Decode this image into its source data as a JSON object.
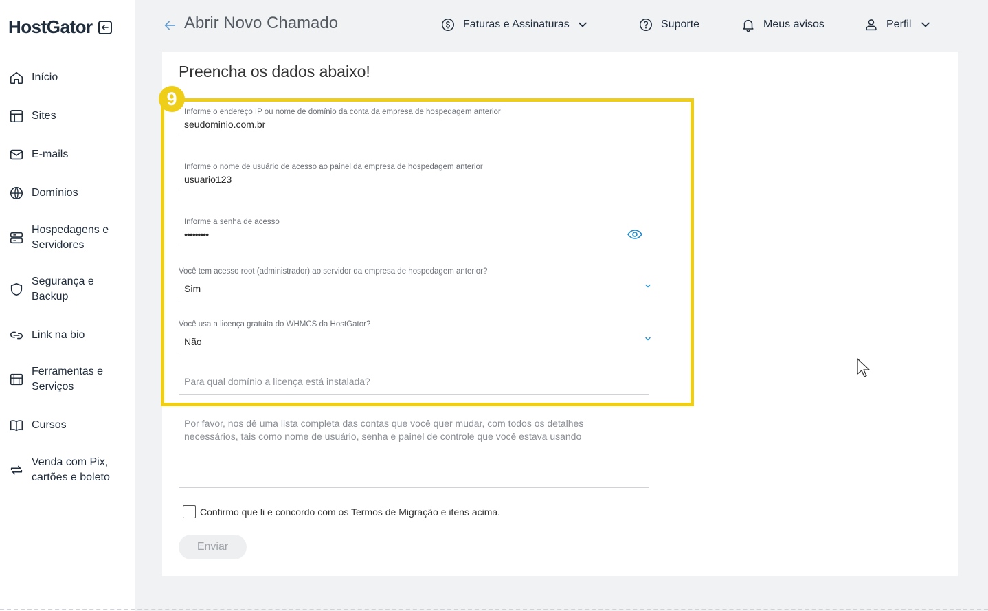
{
  "brand": {
    "name": "HostGator"
  },
  "sidebar": {
    "items": [
      {
        "label": "Início",
        "icon": "home-icon"
      },
      {
        "label": "Sites",
        "icon": "layout-icon"
      },
      {
        "label": "E-mails",
        "icon": "mail-icon"
      },
      {
        "label": "Domínios",
        "icon": "globe-icon"
      },
      {
        "label": "Hospedagens e Servidores",
        "icon": "server-icon"
      },
      {
        "label": "Segurança e Backup",
        "icon": "shield-icon"
      },
      {
        "label": "Link na bio",
        "icon": "link-icon"
      },
      {
        "label": "Ferramentas e Serviços",
        "icon": "tools-icon"
      },
      {
        "label": "Cursos",
        "icon": "book-icon"
      },
      {
        "label": "Venda com Pix, cartões e boleto",
        "icon": "exchange-icon"
      }
    ]
  },
  "header": {
    "title": "Abrir Novo Chamado",
    "nav": {
      "billing": "Faturas e Assinaturas",
      "support": "Suporte",
      "notifications": "Meus avisos",
      "profile": "Perfil"
    }
  },
  "form": {
    "title": "Preencha os dados abaixo!",
    "step_badge": "9",
    "ip_field": {
      "label": "Informe o endereço IP ou nome de domínio da conta da empresa de hospedagem anterior",
      "value": "seudominio.com.br"
    },
    "user_field": {
      "label": "Informe o nome de usuário de acesso ao painel da empresa de hospedagem anterior",
      "value": "usuario123"
    },
    "password_field": {
      "label": "Informe a senha de acesso",
      "value": "•••••••••"
    },
    "root_select": {
      "label": "Você tem acesso root (administrador) ao servidor da empresa de hospedagem anterior?",
      "value": "Sim"
    },
    "whmcs_select": {
      "label": "Você usa a licença gratuita do WHMCS da HostGator?",
      "value": "Não"
    },
    "license_domain": {
      "placeholder": "Para qual domínio a licença está instalada?"
    },
    "accounts_textarea": {
      "placeholder": "Por favor, nos dê uma lista completa das contas que você quer mudar, com todos os detalhes necessários, tais como nome de usuário, senha e painel de controle que você estava usando"
    },
    "terms_checkbox": {
      "label": "Confirmo que li e concordo com os Termos de Migração e itens acima.",
      "checked": false
    },
    "submit_label": "Enviar"
  },
  "colors": {
    "highlight": "#efce1a",
    "accent": "#1e88c9",
    "text_dark": "#1f2d3d"
  }
}
